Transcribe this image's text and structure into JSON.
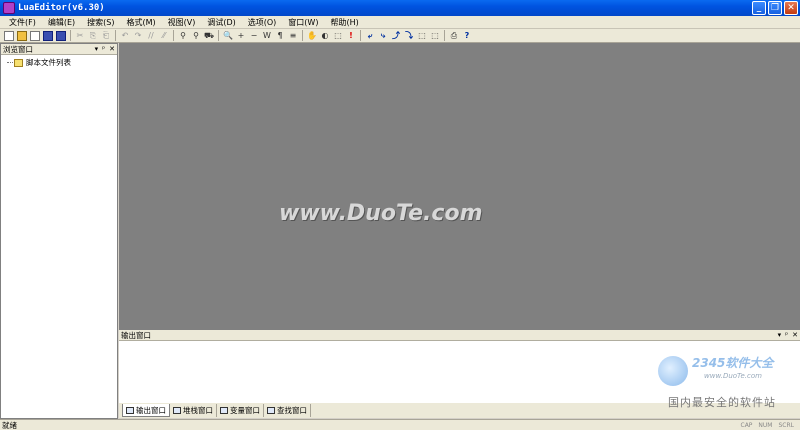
{
  "window": {
    "title": "LuaEditor(v6.30)"
  },
  "menu": [
    "文件(F)",
    "编辑(E)",
    "搜索(S)",
    "格式(M)",
    "视图(V)",
    "调试(D)",
    "选项(O)",
    "窗口(W)",
    "帮助(H)"
  ],
  "toolbar": {
    "glyphs": [
      "",
      "",
      "",
      "",
      "",
      "✂",
      "⎘",
      "⎗",
      "↶",
      "↷",
      "//",
      "⁄⁄",
      "⚲",
      "⚲",
      "⛟",
      "🔍",
      "+",
      "−",
      "W",
      "¶",
      "≡",
      "✋",
      "◐",
      "⬚",
      "!",
      "⤶",
      "⤷",
      "⤴",
      "⤵",
      "⬚",
      "⬚",
      "⎙",
      "?"
    ]
  },
  "browse_panel": {
    "title": "浏览窗口",
    "tree_root": "脚本文件列表"
  },
  "mdi": {
    "watermark": "www.DuoTe.com"
  },
  "output_panel": {
    "title": "输出窗口",
    "tabs": [
      "输出窗口",
      "堆栈窗口",
      "变量窗口",
      "查找窗口"
    ]
  },
  "watermark2": {
    "brand": "2345软件大全",
    "url": "www.DuoTe.com",
    "cn": "国内最安全的软件站"
  },
  "status": {
    "text": "就绪",
    "indicators": [
      "CAP",
      "NUM",
      "SCRL"
    ]
  }
}
